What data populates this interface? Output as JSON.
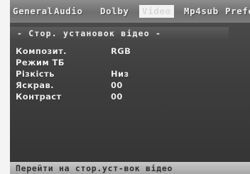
{
  "tabs": [
    {
      "label": "General"
    },
    {
      "label": "Audio"
    },
    {
      "label": "Dolby"
    },
    {
      "label": "Video"
    },
    {
      "label": "Mp4sub"
    },
    {
      "label": "Prefe"
    }
  ],
  "active_tab": "Video",
  "section_title": "- Стор. установок відео -",
  "settings": [
    {
      "label": "Композит.",
      "value": "RGB"
    },
    {
      "label": "Режим ТБ",
      "value": ""
    },
    {
      "label": "Різкість",
      "value": "Низ"
    },
    {
      "label": "Яскрав.",
      "value": "00"
    },
    {
      "label": "Контраст",
      "value": "00"
    }
  ],
  "hint": "Перейти на стор.уст-вок відео"
}
